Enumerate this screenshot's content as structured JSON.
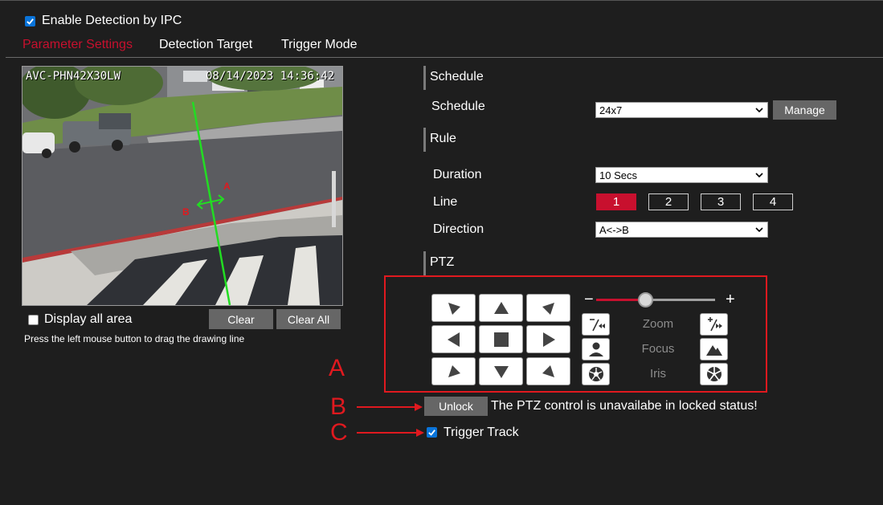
{
  "enable_detection": {
    "label": "Enable Detection by IPC",
    "checked": true
  },
  "tabs": [
    {
      "label": "Parameter Settings",
      "active": true
    },
    {
      "label": "Detection Target",
      "active": false
    },
    {
      "label": "Trigger Mode",
      "active": false
    }
  ],
  "video": {
    "camera_name": "AVC-PHN42X30LW",
    "timestamp": "08/14/2023 14:36:42",
    "line_label_a": "A",
    "line_label_b": "B"
  },
  "display_all_area": {
    "label": "Display all area",
    "checked": false
  },
  "buttons": {
    "clear": "Clear",
    "clear_all": "Clear All",
    "manage": "Manage",
    "unlock": "Unlock"
  },
  "hint": "Press the left mouse button to drag the drawing line",
  "schedule_section": {
    "title": "Schedule",
    "label": "Schedule",
    "value": "24x7"
  },
  "rule_section": {
    "title": "Rule",
    "duration_label": "Duration",
    "duration_value": "10 Secs",
    "line_label": "Line",
    "lines": [
      "1",
      "2",
      "3",
      "4"
    ],
    "active_line": "1",
    "direction_label": "Direction",
    "direction_value": "A<->B"
  },
  "ptz": {
    "title": "PTZ",
    "zoom_label": "Zoom",
    "focus_label": "Focus",
    "iris_label": "Iris",
    "slider_minus": "−",
    "slider_plus": "+",
    "slider_fraction": 0.42,
    "locked_message": "The PTZ control is unavailabe in locked status!"
  },
  "trigger_track": {
    "label": "Trigger Track",
    "checked": true
  },
  "annotations": [
    "A",
    "B",
    "C"
  ],
  "colors": {
    "accent_red": "#c8102e",
    "annotation_red": "#e0191f",
    "background": "#1e1e1e",
    "button_gray": "#666666",
    "line_green": "#22dd22",
    "checkbox_blue": "#0a74da"
  }
}
